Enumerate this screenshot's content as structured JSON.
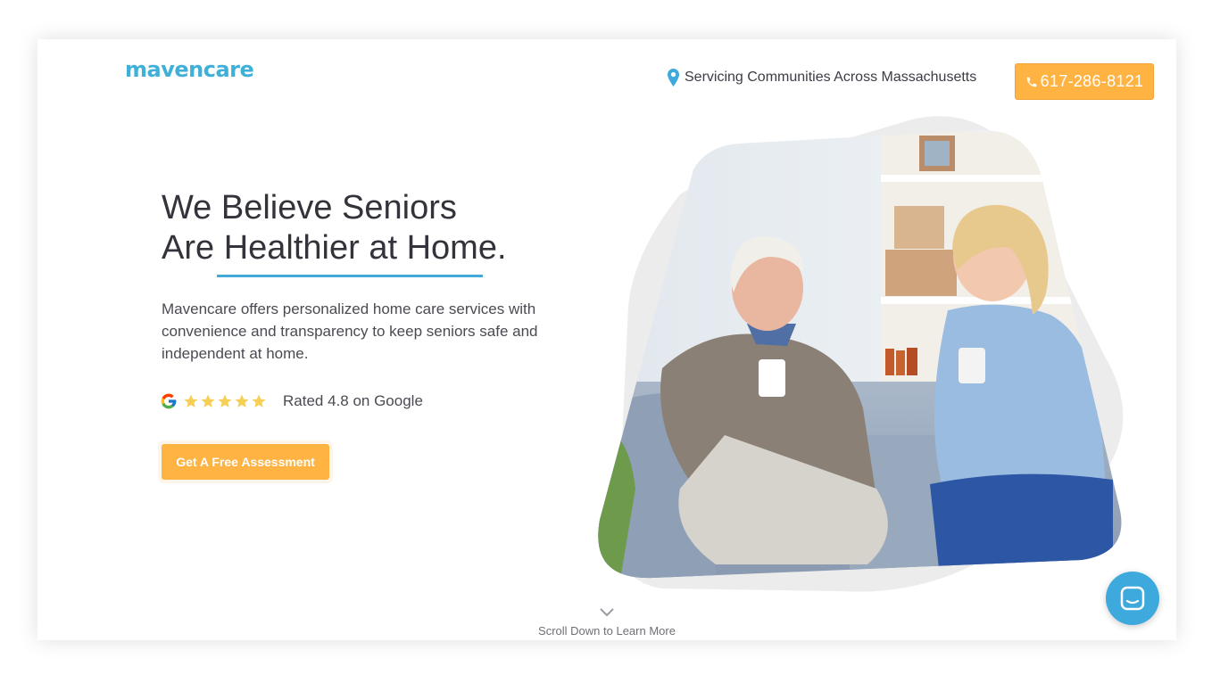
{
  "header": {
    "logo": "mavencare",
    "location_text": "Servicing Communities Across Massachusetts",
    "phone_label": "617-286-8121"
  },
  "hero": {
    "headline_line1": "We Believe Seniors",
    "headline_line2_a": "Are ",
    "headline_line2_b": "Healthier at Home.",
    "description": "Mavencare offers personalized home care services with convenience and transparency to keep seniors safe and independent at home.",
    "rating_value": 4.8,
    "rating_stars": 5,
    "rating_text": "Rated 4.8 on Google",
    "cta_label": "Get A Free Assessment"
  },
  "footer": {
    "scroll_text": "Scroll Down to Learn More"
  },
  "icons": {
    "location": "map-pin-icon",
    "phone": "phone-icon",
    "google": "google-g-icon",
    "star": "star-icon",
    "scroll": "chevron-down-icon",
    "chat": "chat-icon"
  },
  "colors": {
    "brand": "#3fb0d8",
    "accent": "#ffb342",
    "text": "#33333b",
    "star": "#f6cf55"
  }
}
